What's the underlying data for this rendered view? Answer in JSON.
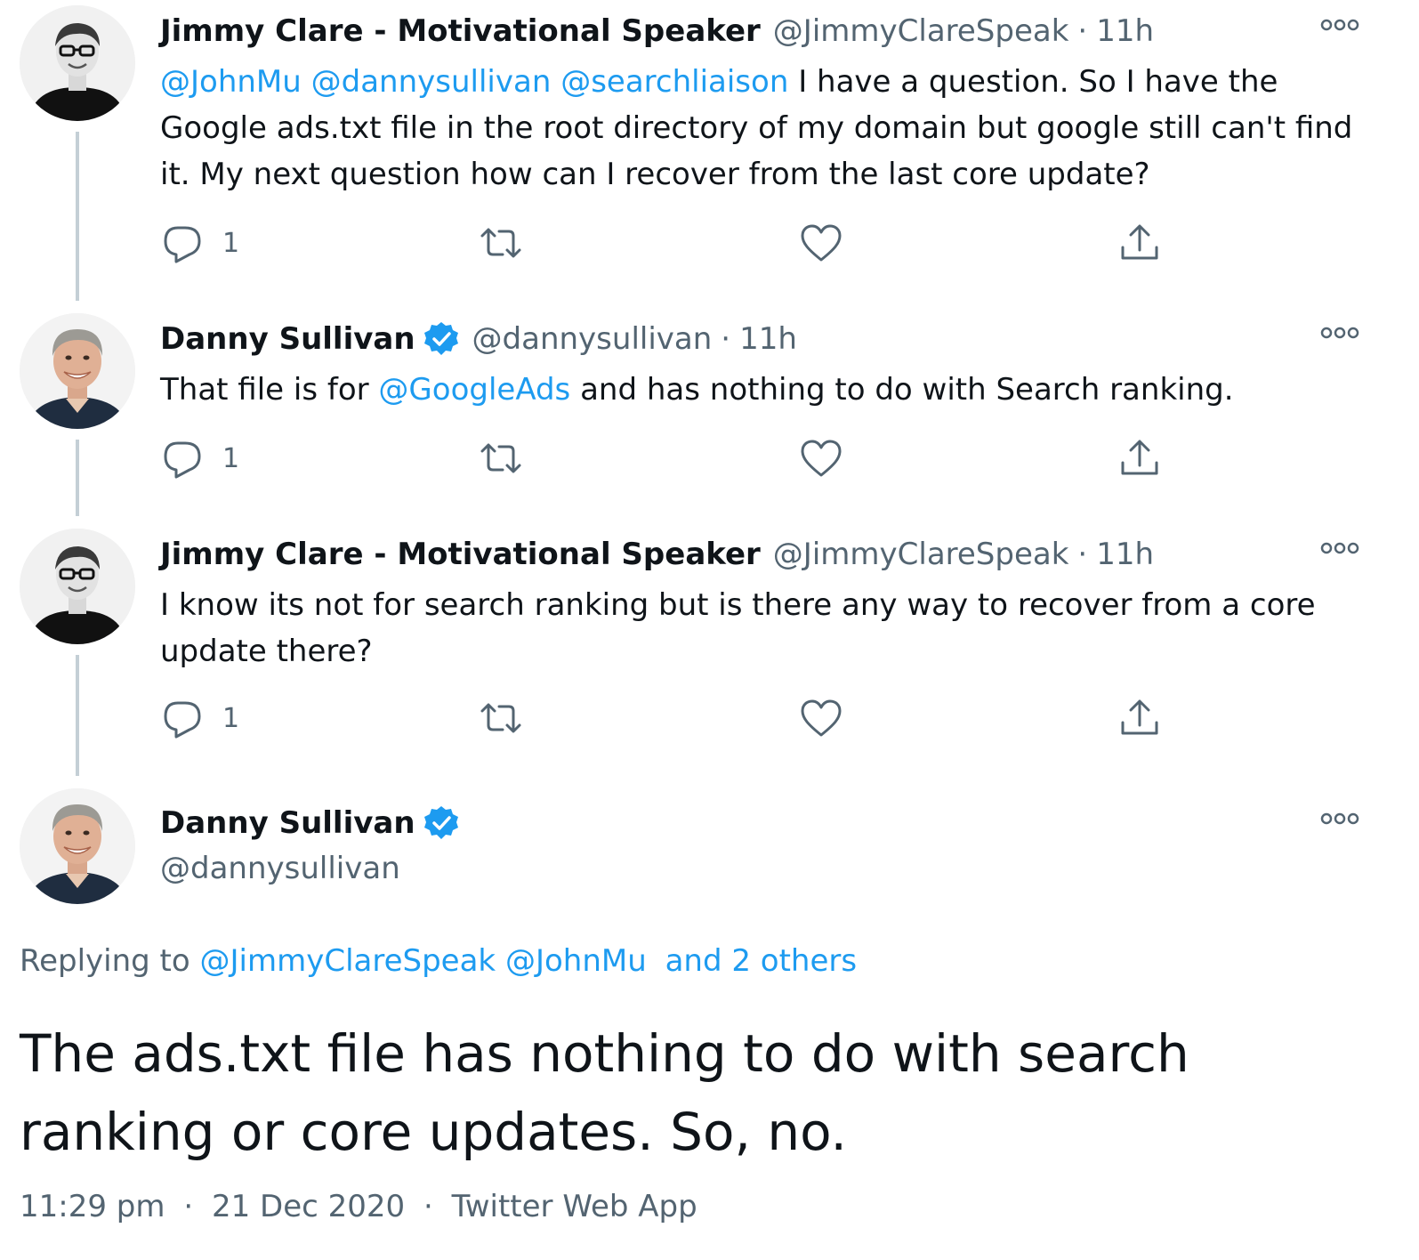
{
  "tweets": [
    {
      "author": "Jimmy Clare - Motivational Speaker",
      "handle": "@JimmyClareSpeak",
      "separator": "·",
      "time": "11h",
      "mentions": [
        "@JohnMu",
        "@dannysullivan",
        "@searchliaison"
      ],
      "text": "I have a question.  So I have the Google ads.txt file in the root directory of my domain but google still can't find it.  My next question how can I recover from the last core update?",
      "reply_count": "1"
    },
    {
      "author": "Danny Sullivan",
      "verified": true,
      "handle": "@dannysullivan",
      "separator": "·",
      "time": "11h",
      "text_before": "That file is for",
      "mention": "@GoogleAds",
      "text_after": "and has nothing to do with Search ranking.",
      "reply_count": "1"
    },
    {
      "author": "Jimmy Clare - Motivational Speaker",
      "handle": "@JimmyClareSpeak",
      "separator": "·",
      "time": "11h",
      "text": "I know its not for search ranking but is there any way to recover from a core update there?",
      "reply_count": "1"
    }
  ],
  "main_tweet": {
    "author": "Danny Sullivan",
    "verified": true,
    "handle": "@dannysullivan",
    "replying_label": "Replying to",
    "replying_mentions": [
      "@JimmyClareSpeak",
      "@JohnMu"
    ],
    "replying_others": "and 2 others",
    "text": "The ads.txt file has nothing to do with search ranking or core updates. So, no.",
    "time": "11:29 pm",
    "separator": "·",
    "date": "21 Dec 2020",
    "source": "Twitter Web App"
  },
  "icons": {
    "reply": "reply-bubble-icon",
    "retweet": "retweet-icon",
    "like": "heart-icon",
    "share": "share-upload-icon",
    "more": "more-options-icon",
    "verified": "verified-badge-icon"
  },
  "colors": {
    "link": "#1d9bf0",
    "secondary_text": "#536471",
    "thread_line": "#c4cfd6",
    "verified": "#1d9bf0"
  }
}
